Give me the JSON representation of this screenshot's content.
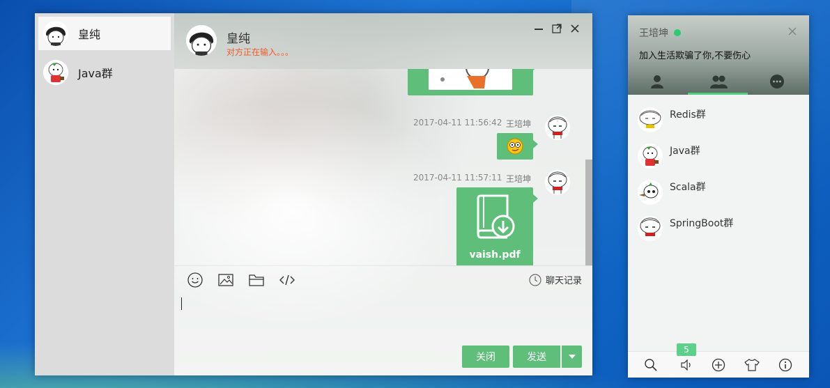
{
  "chat_window": {
    "conversations": [
      {
        "name": "皇纯",
        "active": true
      },
      {
        "name": "Java群",
        "active": false
      }
    ],
    "header": {
      "title": "皇纯",
      "status": "对方正在输入。。。"
    },
    "messages": [
      {
        "time": "2017-04-11 11:56:42",
        "sender": "王培坤",
        "type": "emoji"
      },
      {
        "time": "2017-04-11 11:57:11",
        "sender": "王培坤",
        "type": "file",
        "file_name": "vaish.pdf"
      }
    ],
    "toolbar": {
      "icons": [
        "smile-icon",
        "image-icon",
        "folder-icon",
        "code-icon"
      ],
      "history_label": "聊天记录"
    },
    "buttons": {
      "close_label": "关闭",
      "send_label": "发送"
    }
  },
  "contact_panel": {
    "user_name": "王培坤",
    "signature": "加入生活欺骗了你,不要伤心",
    "tabs": [
      "contacts-icon",
      "groups-icon",
      "chat-icon"
    ],
    "active_tab": "groups-icon",
    "groups": [
      {
        "name": "Redis群"
      },
      {
        "name": "Java群"
      },
      {
        "name": "Scala群"
      },
      {
        "name": "SpringBoot群"
      }
    ],
    "footer": {
      "icons": [
        "search-icon",
        "speaker-icon",
        "add-icon",
        "skin-icon",
        "info-icon"
      ],
      "badge": "5"
    }
  },
  "colors": {
    "accent_green": "#5fbf7a",
    "typing_orange": "#f05a28",
    "online_green": "#2ecc71"
  }
}
